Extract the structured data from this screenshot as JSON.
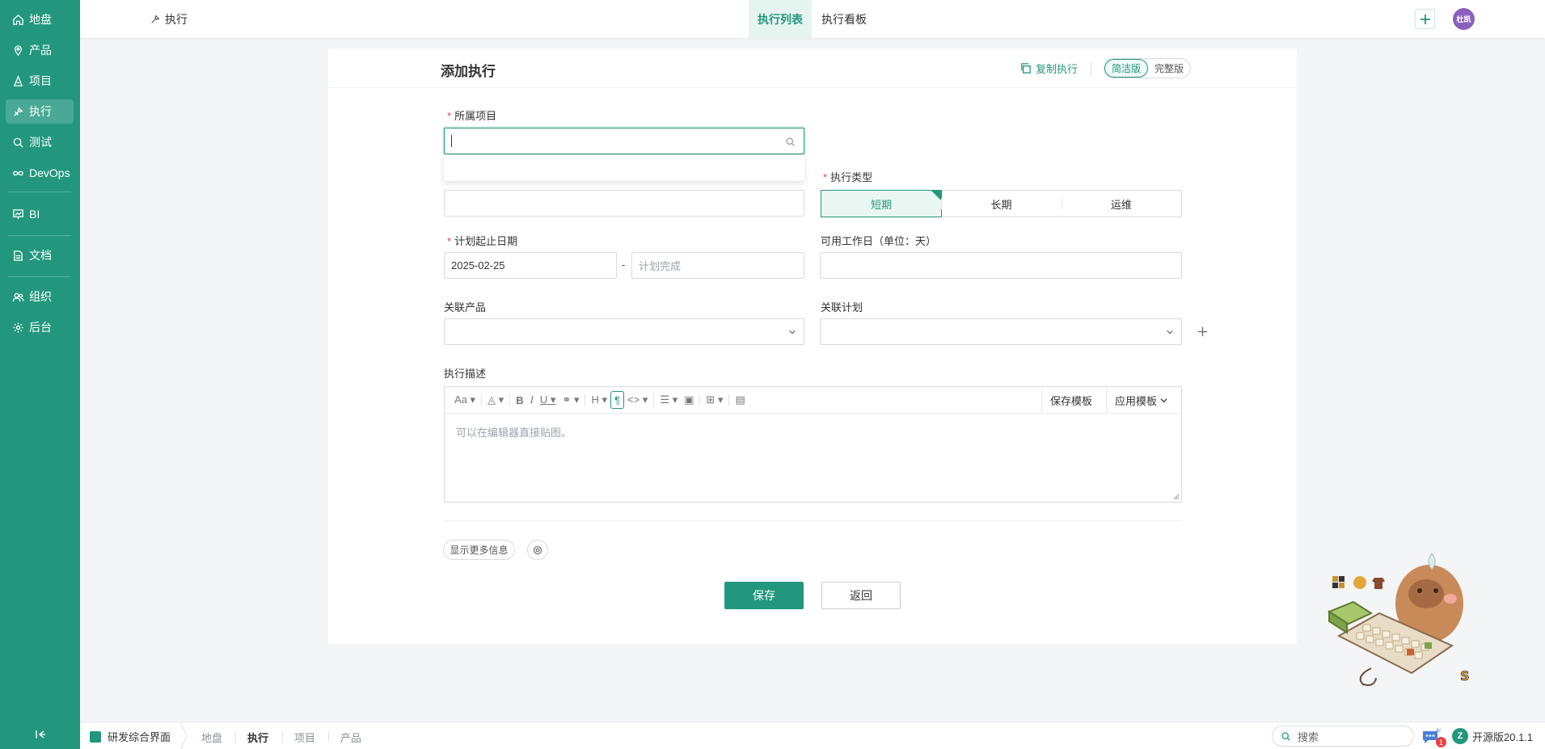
{
  "sidebar": {
    "items": [
      {
        "label": "地盘",
        "icon": "home-icon"
      },
      {
        "label": "产品",
        "icon": "product-icon"
      },
      {
        "label": "项目",
        "icon": "project-icon"
      },
      {
        "label": "执行",
        "icon": "execution-icon",
        "active": true
      },
      {
        "label": "测试",
        "icon": "test-icon"
      },
      {
        "label": "DevOps",
        "icon": "devops-icon"
      },
      {
        "label": "BI",
        "icon": "bi-icon"
      },
      {
        "label": "文档",
        "icon": "doc-icon"
      },
      {
        "label": "组织",
        "icon": "org-icon"
      },
      {
        "label": "后台",
        "icon": "admin-icon"
      }
    ]
  },
  "topbar": {
    "title": "执行",
    "tabs": [
      {
        "label": "执行列表",
        "active": true
      },
      {
        "label": "执行看板",
        "active": false
      }
    ],
    "avatar_text": "杜凯"
  },
  "panel": {
    "title": "添加执行",
    "copy_label": "复制执行",
    "versions": [
      {
        "label": "简洁版",
        "active": true
      },
      {
        "label": "完整版",
        "active": false
      }
    ]
  },
  "form": {
    "project_label": "所属项目",
    "project_value": "",
    "type_label": "执行类型",
    "type_options": [
      "短期",
      "长期",
      "运维"
    ],
    "date_label": "计划起止日期",
    "date_start": "2025-02-25",
    "date_sep": "-",
    "date_end_placeholder": "计划完成",
    "workdays_label": "可用工作日（单位：天）",
    "product_label": "关联产品",
    "plan_label": "关联计划",
    "desc_label": "执行描述",
    "editor_placeholder": "可以在编辑器直接贴图。",
    "save_template": "保存模板",
    "apply_template": "应用模板",
    "more_info": "显示更多信息",
    "save": "保存",
    "back": "返回"
  },
  "statusbar": {
    "app": "研发综合界面",
    "crumbs": [
      {
        "label": "地盘",
        "active": false
      },
      {
        "label": "执行",
        "active": true
      },
      {
        "label": "项目",
        "active": false
      },
      {
        "label": "产品",
        "active": false
      }
    ],
    "search_placeholder": "搜索",
    "ai_label": "AI",
    "ai_badge": "1",
    "version": "开源版20.1.1"
  },
  "colors": {
    "primary": "#22977d",
    "required": "#e54545"
  }
}
